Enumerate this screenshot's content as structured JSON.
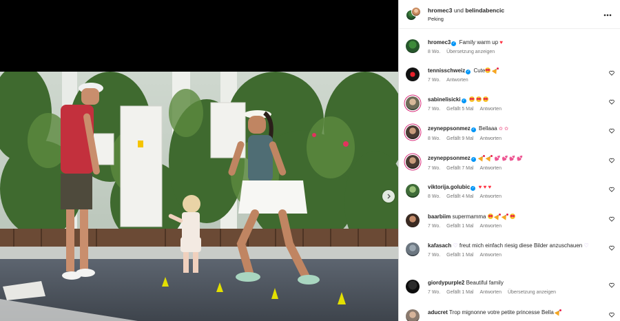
{
  "post": {
    "authors": {
      "first": "hromec3",
      "joiner": "und",
      "second": "belindabencic"
    },
    "location": "Peking"
  },
  "caption": {
    "user": "hromec3",
    "text": "Family warm up",
    "time": "8 Wo.",
    "translate": "Übersetzung anzeigen"
  },
  "comments": [
    {
      "user": "tennisschweiz",
      "verified": true,
      "text": "Cute",
      "time": "7 Wo.",
      "likes": "",
      "reply": "Antworten"
    },
    {
      "user": "sabinelisicki",
      "verified": true,
      "text": "",
      "time": "7 Wo.",
      "likes": "Gefällt 5 Mal",
      "reply": "Antworten"
    },
    {
      "user": "zeyneppsonmez",
      "verified": true,
      "text": "Bellaaa",
      "time": "8 Wo.",
      "likes": "Gefällt 9 Mal",
      "reply": "Antworten"
    },
    {
      "user": "zeyneppsonmez",
      "verified": true,
      "text": "",
      "time": "7 Wo.",
      "likes": "Gefällt 7 Mal",
      "reply": "Antworten"
    },
    {
      "user": "viktorija.golubic",
      "verified": true,
      "text": "",
      "time": "8 Wo.",
      "likes": "Gefällt 4 Mal",
      "reply": "Antworten"
    },
    {
      "user": "baarbiim",
      "verified": false,
      "text": "supermamma",
      "time": "7 Wo.",
      "likes": "Gefällt 1 Mal",
      "reply": "Antworten"
    },
    {
      "user": "kafasach",
      "verified": false,
      "text": "freut mich einfach riesig diese Bilder anzuschauen",
      "time": "7 Wo.",
      "likes": "Gefällt 1 Mal",
      "reply": "Antworten"
    },
    {
      "user": "giordypurple2",
      "verified": false,
      "text": "Beautiful family",
      "time": "7 Wo.",
      "likes": "Gefällt 1 Mal",
      "reply": "Antworten",
      "translate": "Übersetzung anzeigen"
    },
    {
      "user": "aducret",
      "verified": false,
      "text": "Trop mignonne votre petite princesse Bella",
      "time": "",
      "likes": "",
      "reply": ""
    }
  ],
  "colors": {
    "verified": "#0095f6",
    "meta_text": "#737373",
    "story_ring": "#d62976"
  }
}
